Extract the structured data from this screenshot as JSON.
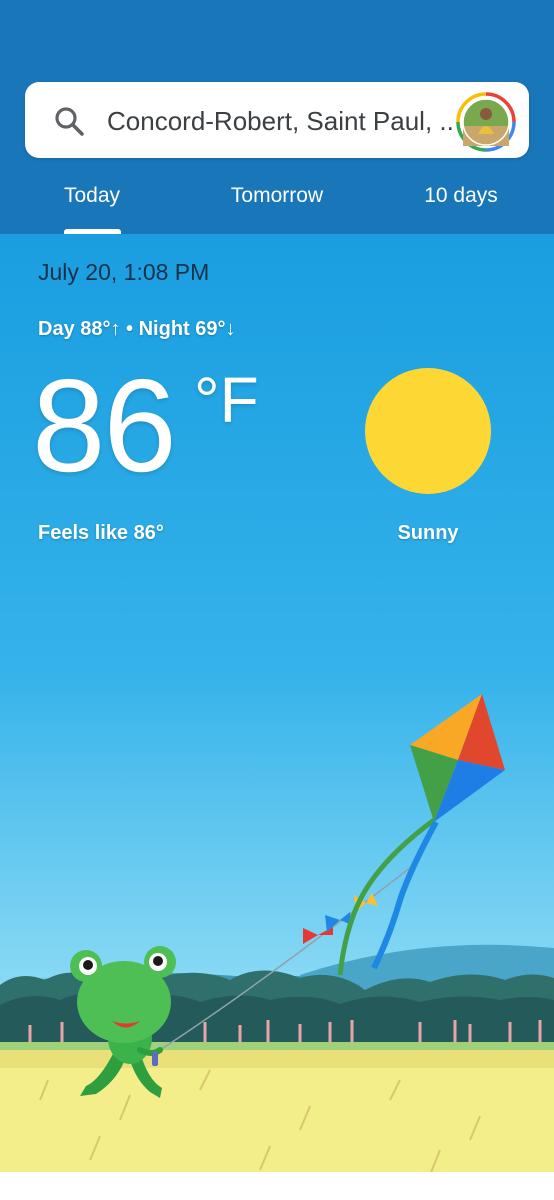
{
  "search": {
    "location_text": "Concord-Robert, Saint Paul, ...",
    "icon": "search-icon"
  },
  "account": {
    "icon": "avatar-icon"
  },
  "tabs": [
    {
      "label": "Today",
      "selected": true
    },
    {
      "label": "Tomorrow",
      "selected": false
    },
    {
      "label": "10 days",
      "selected": false
    }
  ],
  "weather": {
    "datetime": "July 20, 1:08 PM",
    "day_night": "Day 88°↑ • Night 69°↓",
    "temperature": "86",
    "unit": "°F",
    "feels_like": "Feels like 86°",
    "condition": "Sunny",
    "condition_icon": "sun-icon"
  },
  "colors": {
    "header": "#1976b8",
    "sky_top": "#1a9ee0",
    "sky_bottom": "#8fdcf5",
    "sun": "#fdd835",
    "grass": "#f3ee8a"
  }
}
